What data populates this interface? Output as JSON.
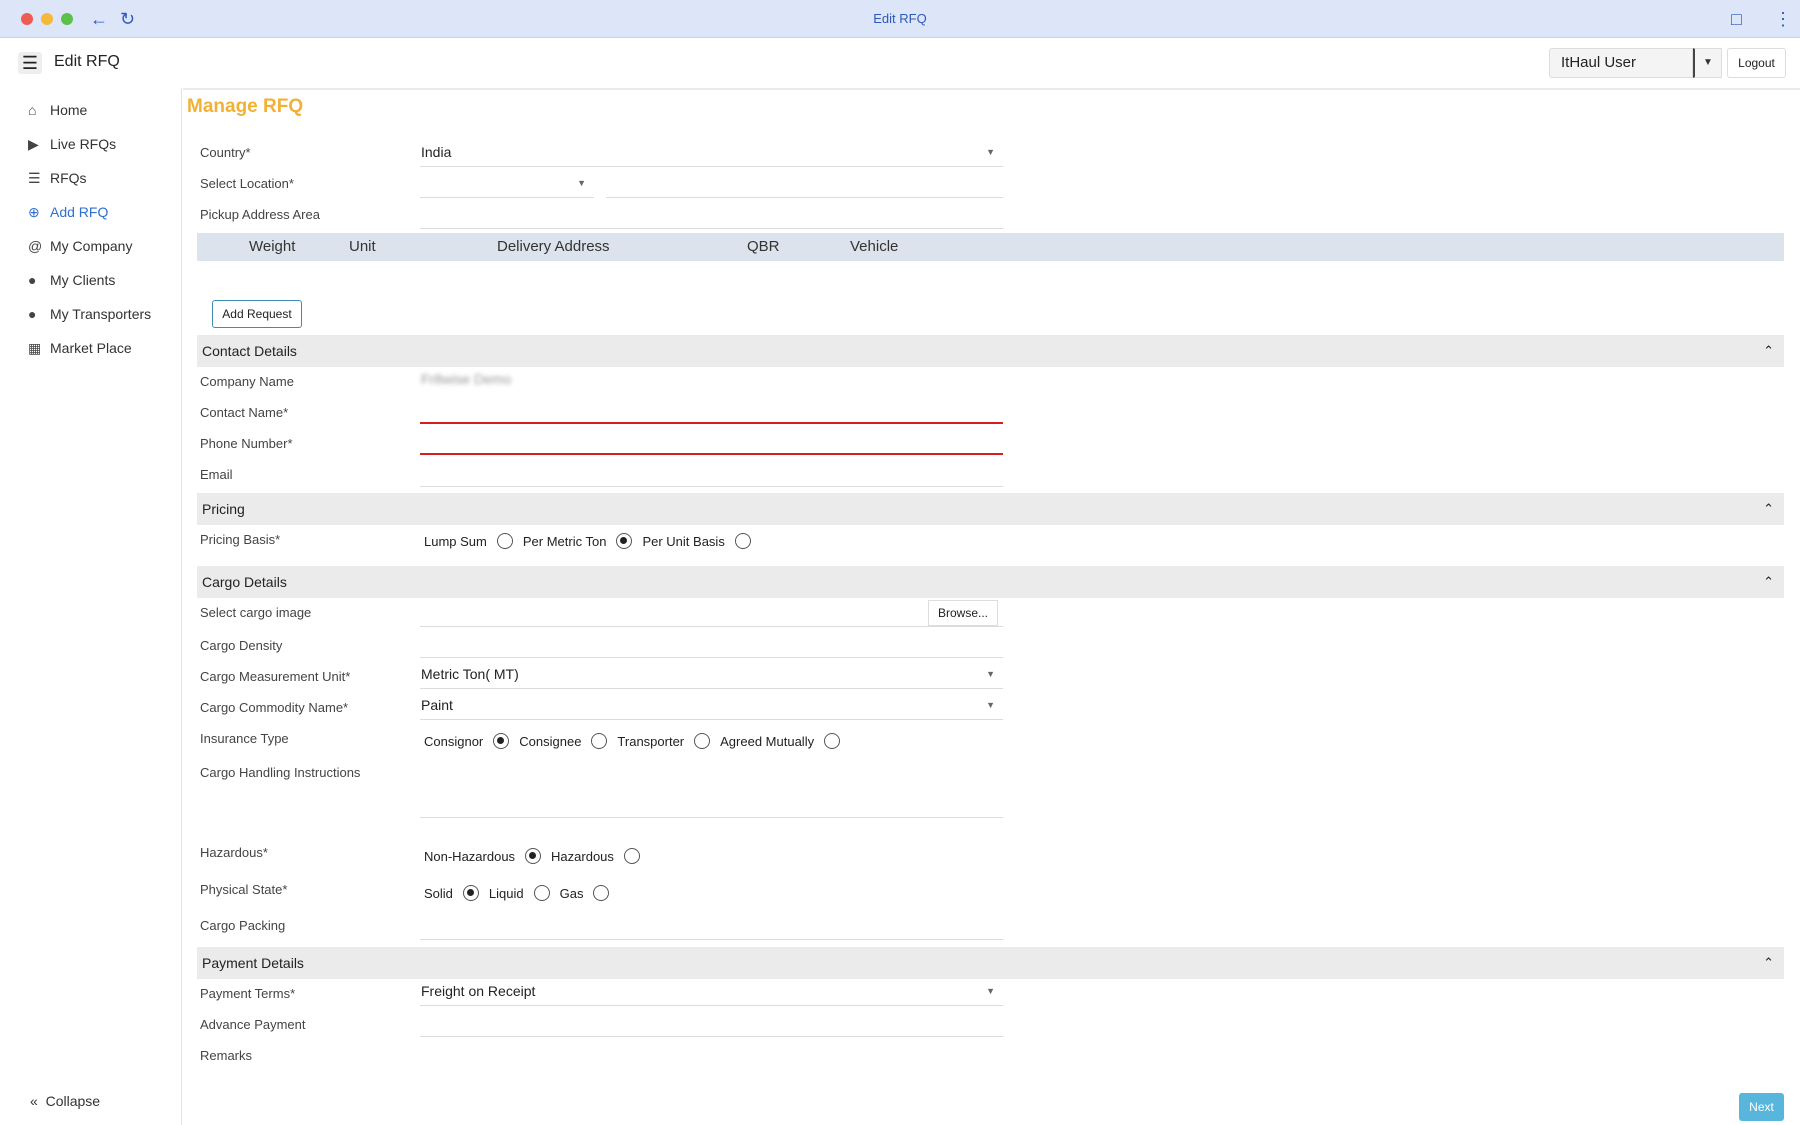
{
  "window": {
    "title": "Edit RFQ"
  },
  "appbar": {
    "title": "Edit RFQ",
    "user": "ItHaul User",
    "logout": "Logout"
  },
  "sidebar": {
    "items": [
      {
        "label": "Home",
        "icon": "home-icon"
      },
      {
        "label": "Live RFQs",
        "icon": "play-icon"
      },
      {
        "label": "RFQs",
        "icon": "list-icon"
      },
      {
        "label": "Add RFQ",
        "icon": "plus-circle-icon",
        "active": true
      },
      {
        "label": "My Company",
        "icon": "at-icon"
      },
      {
        "label": "My Clients",
        "icon": "users-icon"
      },
      {
        "label": "My Transporters",
        "icon": "users-icon"
      },
      {
        "label": "Market Place",
        "icon": "map-icon"
      }
    ],
    "collapse": "Collapse"
  },
  "main": {
    "heading": "Manage RFQ",
    "country": {
      "label": "Country*",
      "value": "India"
    },
    "select_location": {
      "label": "Select Location*"
    },
    "pickup": {
      "label": "Pickup Address Area"
    },
    "table": {
      "headers": [
        "Weight",
        "Unit",
        "Delivery Address",
        "QBR",
        "Vehicle"
      ]
    },
    "add_request": "Add Request",
    "contact": {
      "title": "Contact Details",
      "company_label": "Company Name",
      "company_value": "Fr8wise Demo",
      "contact_label": "Contact Name*",
      "phone_label": "Phone Number*",
      "email_label": "Email"
    },
    "pricing": {
      "title": "Pricing",
      "basis_label": "Pricing Basis*",
      "options": [
        "Lump Sum",
        "Per Metric Ton",
        "Per Unit Basis"
      ],
      "selected": "Per Metric Ton"
    },
    "cargo": {
      "title": "Cargo Details",
      "image_label": "Select cargo image",
      "browse": "Browse...",
      "density_label": "Cargo Density",
      "unit_label": "Cargo Measurement Unit*",
      "unit_value": "Metric Ton( MT)",
      "commodity_label": "Cargo Commodity Name*",
      "commodity_value": "Paint",
      "insurance_label": "Insurance Type",
      "insurance_options": [
        "Consignor",
        "Consignee",
        "Transporter",
        "Agreed Mutually"
      ],
      "insurance_selected": "Consignor",
      "handling_label": "Cargo Handling Instructions",
      "hazardous_label": "Hazardous*",
      "hazardous_options": [
        "Non-Hazardous",
        "Hazardous"
      ],
      "hazardous_selected": "Non-Hazardous",
      "physical_label": "Physical State*",
      "physical_options": [
        "Solid",
        "Liquid",
        "Gas"
      ],
      "physical_selected": "Solid",
      "packing_label": "Cargo Packing"
    },
    "payment": {
      "title": "Payment Details",
      "terms_label": "Payment Terms*",
      "terms_value": "Freight on Receipt",
      "advance_label": "Advance Payment",
      "remarks_label": "Remarks"
    },
    "next": "Next"
  }
}
